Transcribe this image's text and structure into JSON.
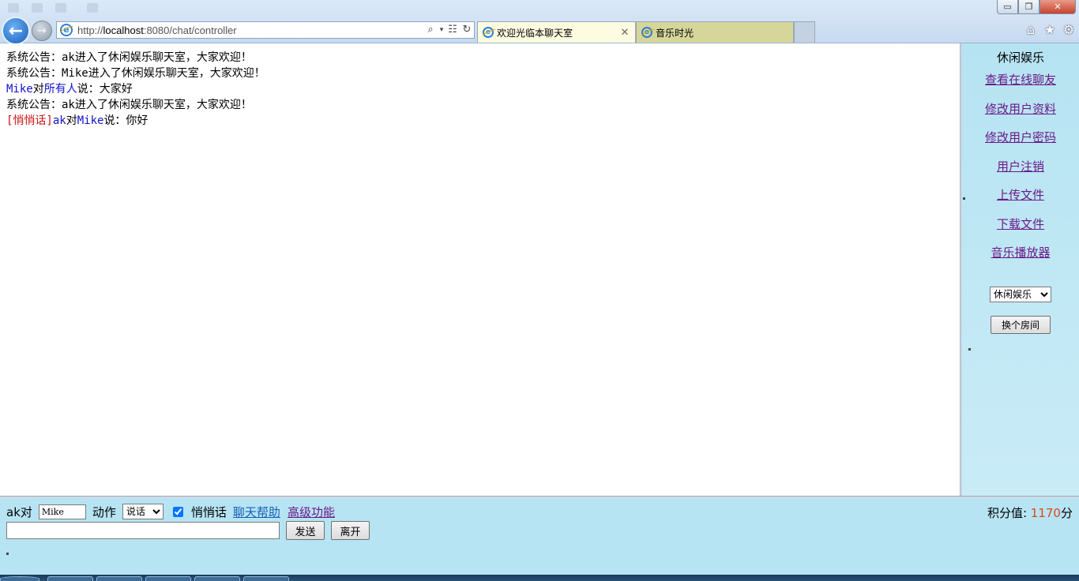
{
  "browser": {
    "address_url_prefix": "http://",
    "address_url_host": "localhost",
    "address_url_rest": ":8080/chat/controller",
    "tabs": [
      {
        "label": "欢迎光临本聊天室",
        "active": true
      },
      {
        "label": "音乐时光",
        "active": false
      }
    ],
    "window_controls": {
      "minimize": "▭",
      "maximize": "❐",
      "close": "✕"
    },
    "icons": {
      "back": "arrow-left-icon",
      "forward": "arrow-right-icon",
      "search": "search-icon",
      "compat": "compatibility-icon",
      "refresh": "refresh-icon",
      "home": "home-icon",
      "favorites": "star-icon",
      "tools": "gear-icon"
    }
  },
  "chat": {
    "messages": [
      {
        "parts": [
          {
            "text": "系统公告：ak进入了休闲娱乐聊天室，大家欢迎！",
            "color": "black"
          }
        ]
      },
      {
        "parts": [
          {
            "text": "系统公告：Mike进入了休闲娱乐聊天室，大家欢迎！",
            "color": "black"
          }
        ]
      },
      {
        "parts": [
          {
            "text": "Mike",
            "color": "blue"
          },
          {
            "text": "对",
            "color": "black"
          },
          {
            "text": "所有人",
            "color": "blue"
          },
          {
            "text": "说：大家好",
            "color": "black"
          }
        ]
      },
      {
        "parts": [
          {
            "text": "系统公告：ak进入了休闲娱乐聊天室，大家欢迎！",
            "color": "black"
          }
        ]
      },
      {
        "parts": [
          {
            "text": "[悄悄话]",
            "color": "red"
          },
          {
            "text": "ak",
            "color": "blue"
          },
          {
            "text": "对",
            "color": "black"
          },
          {
            "text": "Mike",
            "color": "blue"
          },
          {
            "text": "说：你好",
            "color": "black"
          }
        ]
      }
    ]
  },
  "sidebar": {
    "room_title": "休闲娱乐",
    "links": [
      {
        "label": "查看在线聊友",
        "name": "link-view-online-users"
      },
      {
        "label": "修改用户资料",
        "name": "link-edit-profile"
      },
      {
        "label": "修改用户密码",
        "name": "link-change-password"
      },
      {
        "label": "用户注销",
        "name": "link-logout"
      },
      {
        "label": "上传文件",
        "name": "link-upload-file"
      },
      {
        "label": "下载文件",
        "name": "link-download-file"
      },
      {
        "label": "音乐播放器",
        "name": "link-music-player"
      }
    ],
    "room_select_value": "休闲娱乐",
    "change_room_label": "换个房间"
  },
  "bottom": {
    "speaker_label": "ak对",
    "target_value": "Mike",
    "action_label": "动作",
    "action_select_value": "说话",
    "whisper_checked": true,
    "whisper_label": "悄悄话",
    "help_link": "聊天帮助",
    "advanced_link": "高级功能",
    "message_value": "",
    "send_label": "发送",
    "leave_label": "离开",
    "score_label": "积分值:",
    "score_value": "1170",
    "score_unit": "分"
  },
  "colors": {
    "sidebar_bg": "#b6e3f2",
    "bottom_bg": "#b7e4f3",
    "chat_blue": "#1111cc",
    "chat_red": "#cc1111",
    "score_accent": "#e0441c",
    "visited_link": "#6a1a8a",
    "link": "#1a5fb8"
  }
}
